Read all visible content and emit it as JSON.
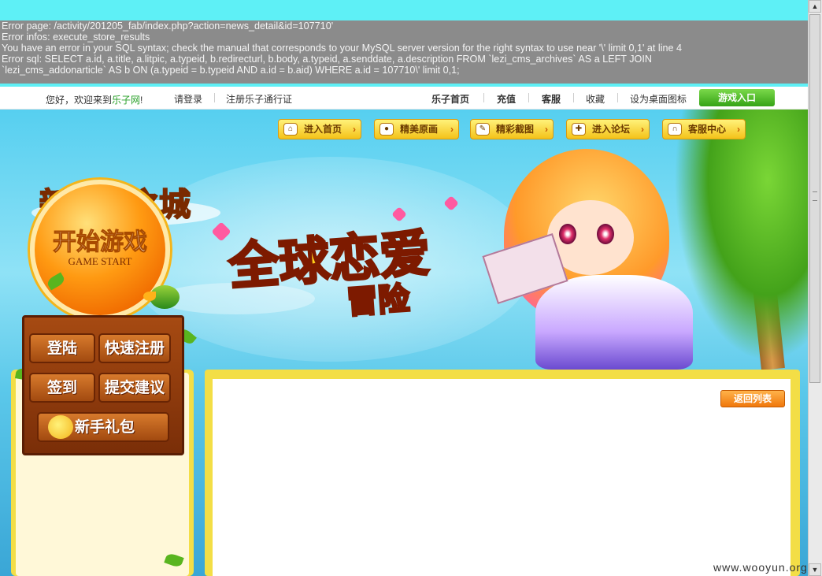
{
  "error": {
    "lines": [
      "Error page: /activity/201205_fab/index.php?action=news_detail&id=107710'",
      "Error infos: execute_store_results",
      "You have an error in your SQL syntax; check the manual that corresponds to your MySQL server version for the right syntax to use near '\\' limit 0,1' at line 4",
      "Error sql: SELECT a.id, a.title, a.litpic, a.typeid, b.redirecturl, b.body, a.typeid, a.senddate, a.description FROM `lezi_cms_archives` AS a LEFT JOIN",
      "`lezi_cms_addonarticle` AS b ON (a.typeid = b.typeid AND a.id = b.aid) WHERE a.id = 107710\\' limit 0,1;"
    ]
  },
  "topbar": {
    "greeting": "您好，欢迎来到",
    "site_name": "乐子网",
    "exclaim": "!",
    "login": "请登录",
    "register": "注册乐子通行证",
    "home": "乐子首页",
    "recharge": "充值",
    "service": "客服",
    "favorite": "收藏",
    "desktop_icon": "设为桌面图标",
    "game_entry": "游戏入口"
  },
  "nav": [
    {
      "label": "进入首页",
      "icon": "home-icon"
    },
    {
      "label": "精美原画",
      "icon": "lock-icon"
    },
    {
      "label": "精彩截图",
      "icon": "pencil-icon"
    },
    {
      "label": "进入论坛",
      "icon": "gamepad-icon"
    },
    {
      "label": "客服中心",
      "icon": "headset-icon"
    }
  ],
  "logo_text": "新梦幻之城",
  "slogan": {
    "line1": "全球恋爱",
    "line2": "冒险"
  },
  "start_button": {
    "cn": "开始游戏",
    "en": "GAME START"
  },
  "side_buttons": {
    "login": "登陆",
    "quick_register": "快速注册",
    "checkin": "签到",
    "suggest": "提交建议",
    "newbie_gift": "新手礼包"
  },
  "content": {
    "back_to_list": "返回列表"
  },
  "watermark": "www.wooyun.org",
  "scrollbar": {
    "up": "▲",
    "down": "▼"
  },
  "colors": {
    "page_bg": "#5ef0f6",
    "accent_green": "#35a316",
    "panel_yellow": "#f3de46",
    "error_bg": "#8b8b8b"
  }
}
